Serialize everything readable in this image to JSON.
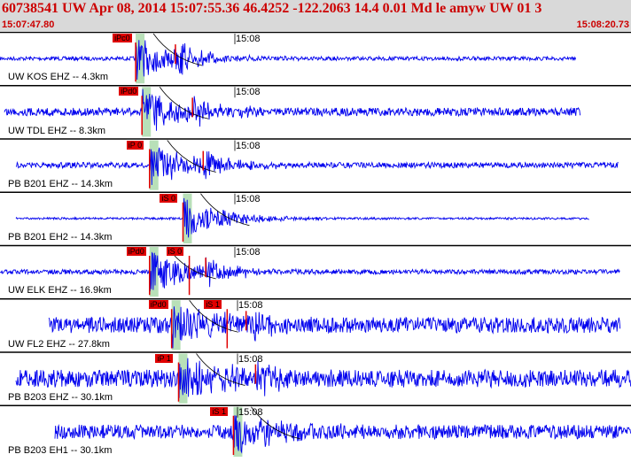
{
  "header": {
    "title": "60738541 UW Apr 08, 2014 15:07:55.36   46.4252 -122.2063 14.4 0.01 Md le amyw UW 01   3",
    "start_time": "15:07:47.80",
    "end_time": "15:08:20.73"
  },
  "tick_label": "15:08",
  "colors": {
    "title": "#cc0000",
    "trace": "#0000ee",
    "pick": "#e00000",
    "window": "#b8e0b8",
    "header_bg": "#d9d9d9"
  },
  "traces": [
    {
      "label": "UW KOS EHZ -- 4.3km",
      "picks": [
        {
          "text": "iPc0",
          "pos": 0.215
        }
      ],
      "s_mark": 0.278
    },
    {
      "label": "UW TDL EHZ -- 8.3km",
      "picks": [
        {
          "text": "iPd0",
          "pos": 0.225
        }
      ],
      "s_mark": 0.305
    },
    {
      "label": "PB B201 EHZ -- 14.3km",
      "picks": [
        {
          "text": "iP 0",
          "pos": 0.237
        }
      ],
      "s_mark": 0.322
    },
    {
      "label": "PB B201 EH2 -- 14.3km",
      "picks": [
        {
          "text": "iS 0",
          "pos": 0.29
        }
      ],
      "s_mark": null
    },
    {
      "label": "UW ELK EHZ -- 16.9km",
      "picks": [
        {
          "text": "iPd0",
          "pos": 0.237
        },
        {
          "text": "iS 0",
          "pos": 0.3
        }
      ],
      "s_mark": 0.326
    },
    {
      "label": "UW FL2 EHZ -- 27.8km",
      "picks": [
        {
          "text": "iPd0",
          "pos": 0.272
        },
        {
          "text": "iS 1",
          "pos": 0.36
        }
      ],
      "s_mark": 0.39
    },
    {
      "label": "PB B203 EHZ -- 30.1km",
      "picks": [
        {
          "text": "iP 1",
          "pos": 0.283
        }
      ],
      "s_mark": 0.405
    },
    {
      "label": "PB B203 EH1 -- 30.1km",
      "picks": [
        {
          "text": "iS 1",
          "pos": 0.37
        }
      ],
      "s_mark": null
    }
  ]
}
